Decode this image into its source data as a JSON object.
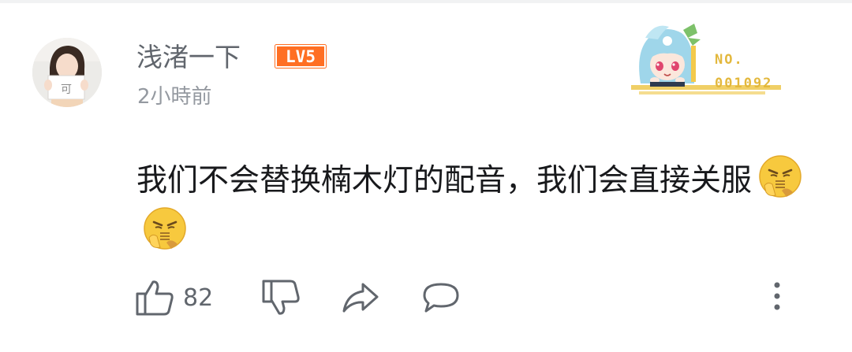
{
  "comment": {
    "username": "浅渚一下",
    "level_badge": "LV5",
    "timestamp": "2小時前",
    "text": "我们不会替换楠木灯的配音，我们会直接关服",
    "emoji_names": [
      "sick-face-emoji",
      "sick-face-emoji"
    ]
  },
  "fan_badge": {
    "label": "NO.",
    "number": "001092"
  },
  "actions": {
    "like_count": "82"
  },
  "colors": {
    "level_orange": "#ff6f23",
    "username_gray": "#61666d",
    "meta_gray": "#9499a0",
    "badge_gold": "#e3b83d"
  },
  "icons": [
    "thumb-up-icon",
    "thumb-down-icon",
    "share-icon",
    "reply-icon",
    "more-vertical-icon"
  ]
}
